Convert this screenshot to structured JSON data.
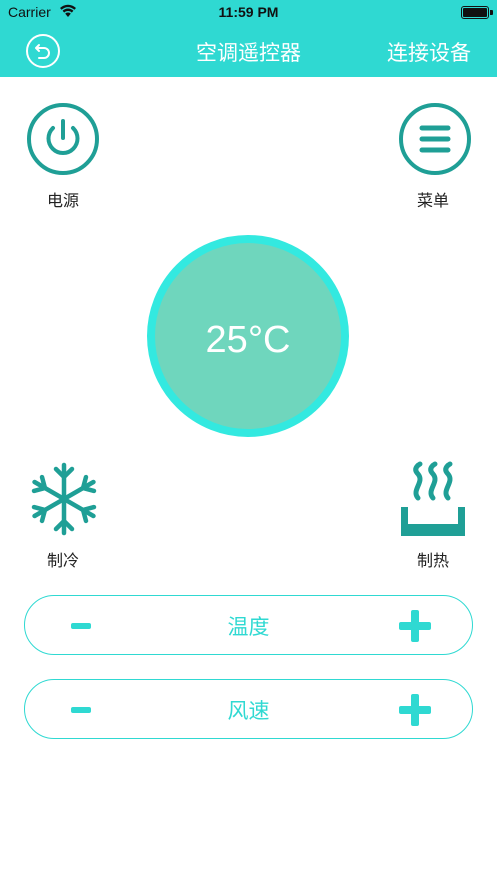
{
  "status_bar": {
    "carrier": "Carrier",
    "time": "11:59 PM"
  },
  "nav": {
    "title": "空调遥控器",
    "connect_label": "连接设备"
  },
  "controls": {
    "power_label": "电源",
    "menu_label": "菜单",
    "cool_label": "制冷",
    "heat_label": "制热"
  },
  "dial": {
    "temperature": "25°C"
  },
  "adjusters": {
    "temperature_label": "温度",
    "fan_speed_label": "风速"
  },
  "colors": {
    "accent": "#2fd9d2",
    "icon": "#1f9f96",
    "dial_fill": "#6fd6bd",
    "dial_ring": "#33e9e0"
  },
  "icons": [
    "wifi-icon",
    "battery-icon",
    "back-icon",
    "power-icon",
    "menu-icon",
    "snowflake-icon",
    "heat-icon",
    "minus-icon",
    "plus-icon"
  ]
}
